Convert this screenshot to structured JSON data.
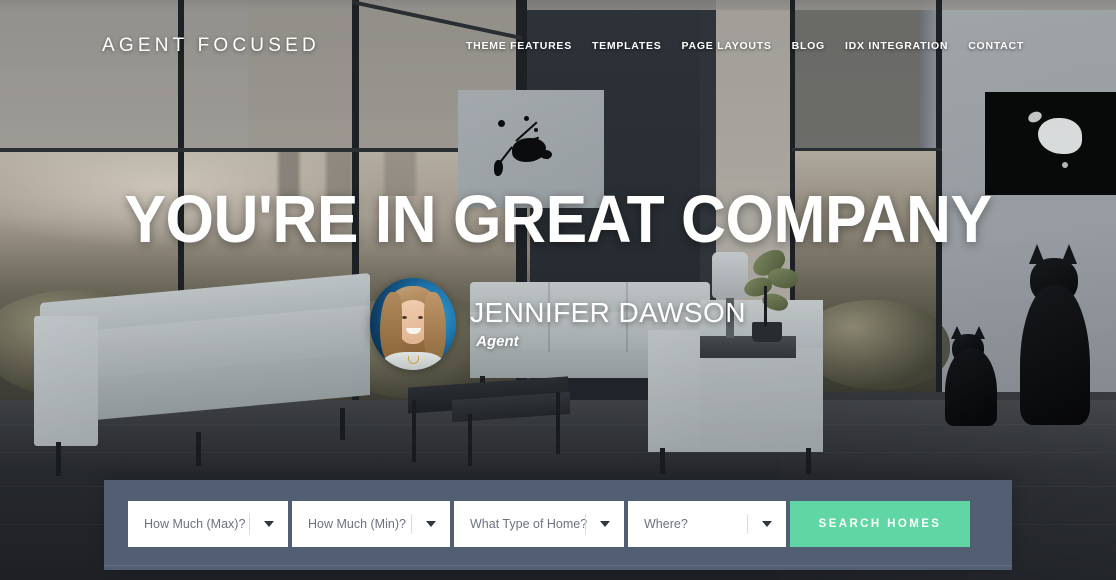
{
  "header": {
    "brand": "AGENT FOCUSED",
    "nav": [
      {
        "label": "THEME FEATURES"
      },
      {
        "label": "TEMPLATES"
      },
      {
        "label": "PAGE LAYOUTS"
      },
      {
        "label": "BLOG"
      },
      {
        "label": "IDX INTEGRATION"
      },
      {
        "label": "CONTACT"
      }
    ]
  },
  "hero": {
    "heading": "YOU'RE IN GREAT COMPANY",
    "agent": {
      "name": "JENNIFER DAWSON",
      "role": "Agent"
    }
  },
  "search": {
    "fields": [
      {
        "placeholder": "How Much (Max)?"
      },
      {
        "placeholder": "How Much (Min)?"
      },
      {
        "placeholder": "What Type of Home?"
      },
      {
        "placeholder": "Where?"
      }
    ],
    "button_label": "SEARCH HOMES"
  },
  "colors": {
    "accent_green": "#5fd6a4",
    "search_bar_bg": "#525f73",
    "text_white": "#ffffff",
    "field_text": "#6b7280"
  }
}
